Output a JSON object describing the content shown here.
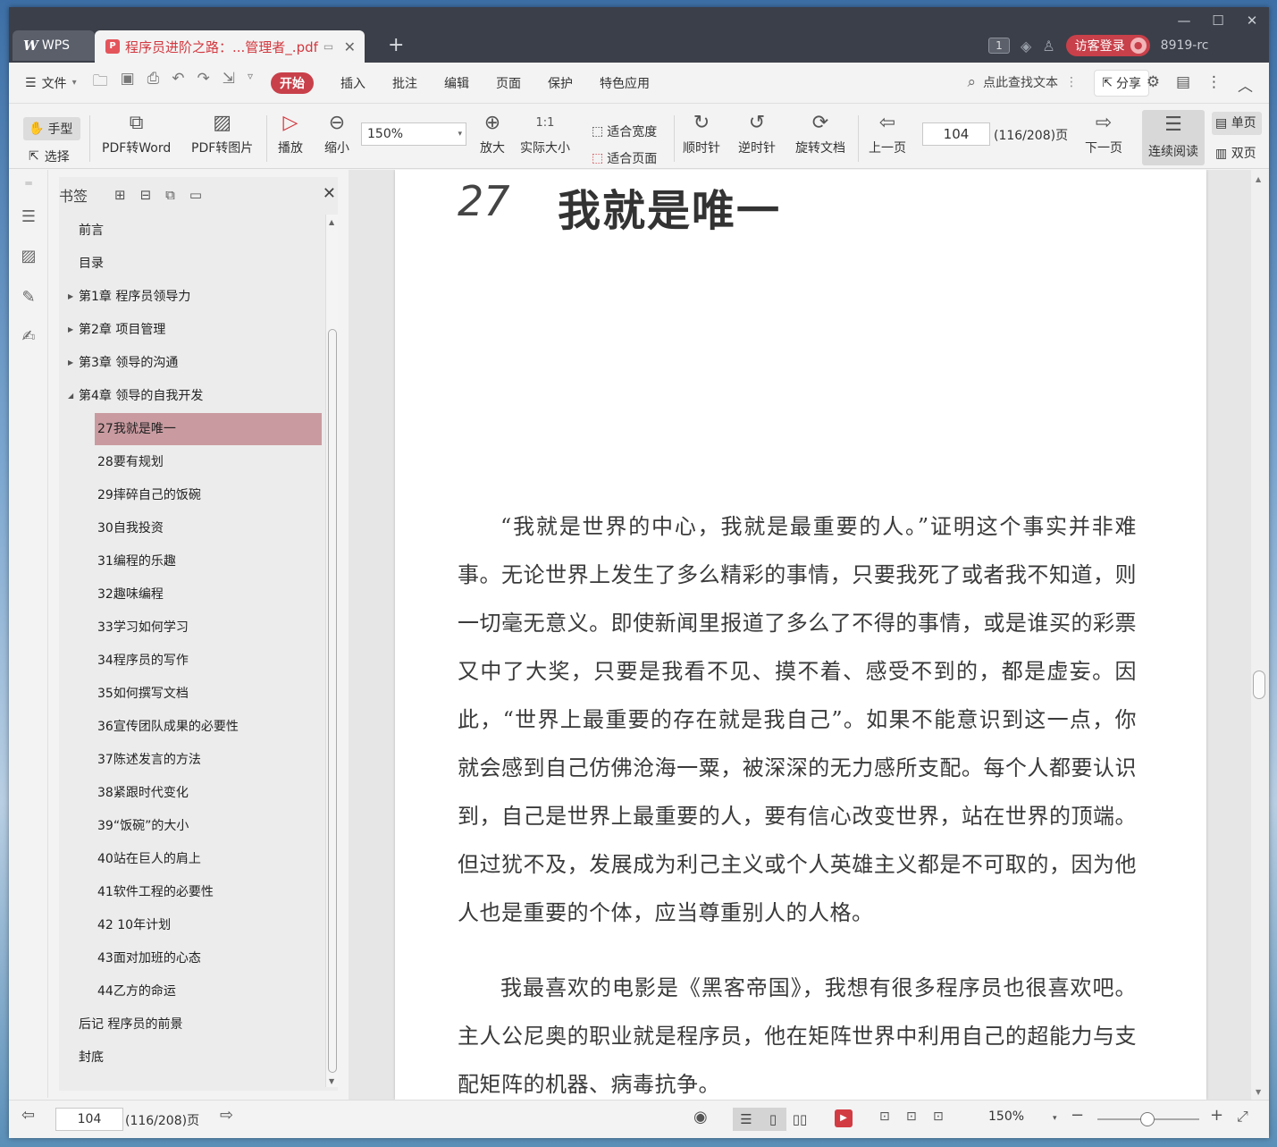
{
  "titlebar": {
    "app_tab": "WPS",
    "doc_tab": "程序员进阶之路：...管理者_.pdf",
    "counter": "1",
    "login": "访客登录",
    "user": "8919-rc"
  },
  "menubar": {
    "file": "文件",
    "items": [
      "开始",
      "插入",
      "批注",
      "编辑",
      "页面",
      "保护",
      "特色应用"
    ],
    "search": "点此查找文本",
    "share": "分享"
  },
  "toolbar": {
    "hand": "手型",
    "select": "选择",
    "pdf_to_word": "PDF转Word",
    "pdf_to_image": "PDF转图片",
    "play": "播放",
    "zoom_out": "缩小",
    "zoom_value": "150%",
    "zoom_in": "放大",
    "actual_size": "实际大小",
    "fit_width": "适合宽度",
    "fit_page": "适合页面",
    "clockwise": "顺时针",
    "counterclockwise": "逆时针",
    "rotate_doc": "旋转文档",
    "prev_page": "上一页",
    "page_value": "104",
    "page_total": "(116/208)页",
    "next_page": "下一页",
    "continuous": "连续阅读",
    "single": "单页",
    "double": "双页"
  },
  "bookmarks": {
    "title": "书签",
    "items": [
      {
        "label": "前言",
        "level": 0,
        "expander": ""
      },
      {
        "label": "目录",
        "level": 0,
        "expander": ""
      },
      {
        "label": "第1章  程序员领导力",
        "level": 0,
        "expander": "▶"
      },
      {
        "label": "第2章  项目管理",
        "level": 0,
        "expander": "▶"
      },
      {
        "label": "第3章  领导的沟通",
        "level": 0,
        "expander": "▶"
      },
      {
        "label": "第4章  领导的自我开发",
        "level": 0,
        "expander": "◢"
      },
      {
        "label": "27我就是唯一",
        "level": 1,
        "expander": ""
      },
      {
        "label": "28要有规划",
        "level": 1,
        "expander": ""
      },
      {
        "label": "29摔碎自己的饭碗",
        "level": 1,
        "expander": ""
      },
      {
        "label": "30自我投资",
        "level": 1,
        "expander": ""
      },
      {
        "label": "31编程的乐趣",
        "level": 1,
        "expander": ""
      },
      {
        "label": "32趣味编程",
        "level": 1,
        "expander": ""
      },
      {
        "label": "33学习如何学习",
        "level": 1,
        "expander": ""
      },
      {
        "label": "34程序员的写作",
        "level": 1,
        "expander": ""
      },
      {
        "label": "35如何撰写文档",
        "level": 1,
        "expander": ""
      },
      {
        "label": "36宣传团队成果的必要性",
        "level": 1,
        "expander": ""
      },
      {
        "label": "37陈述发言的方法",
        "level": 1,
        "expander": ""
      },
      {
        "label": "38紧跟时代变化",
        "level": 1,
        "expander": ""
      },
      {
        "label": "39“饭碗”的大小",
        "level": 1,
        "expander": ""
      },
      {
        "label": "40站在巨人的肩上",
        "level": 1,
        "expander": ""
      },
      {
        "label": "41软件工程的必要性",
        "level": 1,
        "expander": ""
      },
      {
        "label": "42  10年计划",
        "level": 1,
        "expander": ""
      },
      {
        "label": "43面对加班的心态",
        "level": 1,
        "expander": ""
      },
      {
        "label": "44乙方的命运",
        "level": 1,
        "expander": ""
      },
      {
        "label": "后记  程序员的前景",
        "level": 0,
        "expander": ""
      },
      {
        "label": "封底",
        "level": 0,
        "expander": ""
      }
    ],
    "active": "27我就是唯一"
  },
  "document": {
    "chapter_number": "27",
    "chapter_title": "我就是唯一",
    "paragraph_1": "“我就是世界的中心，我就是最重要的人。”证明这个事实并非难事。无论世界上发生了多么精彩的事情，只要我死了或者我不知道，则一切毫无意义。即使新闻里报道了多么了不得的事情，或是谁买的彩票又中了大奖，只要是我看不见、摸不着、感受不到的，都是虚妄。因此，“世界上最重要的存在就是我自己”。如果不能意识到这一点，你就会感到自己仿佛沧海一粟，被深深的无力感所支配。每个人都要认识到，自己是世界上最重要的人，要有信心改变世界，站在世界的顶端。但过犹不及，发展成为利己主义或个人英雄主义都是不可取的，因为他人也是重要的个体，应当尊重别人的人格。",
    "paragraph_2": "我最喜欢的电影是《黑客帝国》，我想有很多程序员也很喜欢吧。主人公尼奥的职业就是程序员，他在矩阵世界中利用自己的超能力与支配矩阵的机器、病毒抗争。"
  },
  "statusbar": {
    "page_value": "104",
    "page_total": "(116/208)页",
    "zoom": "150%"
  },
  "colors": {
    "accent": "#c8404a",
    "active_bookmark": "#c99ba0",
    "titlebar": "#3b3f49"
  }
}
